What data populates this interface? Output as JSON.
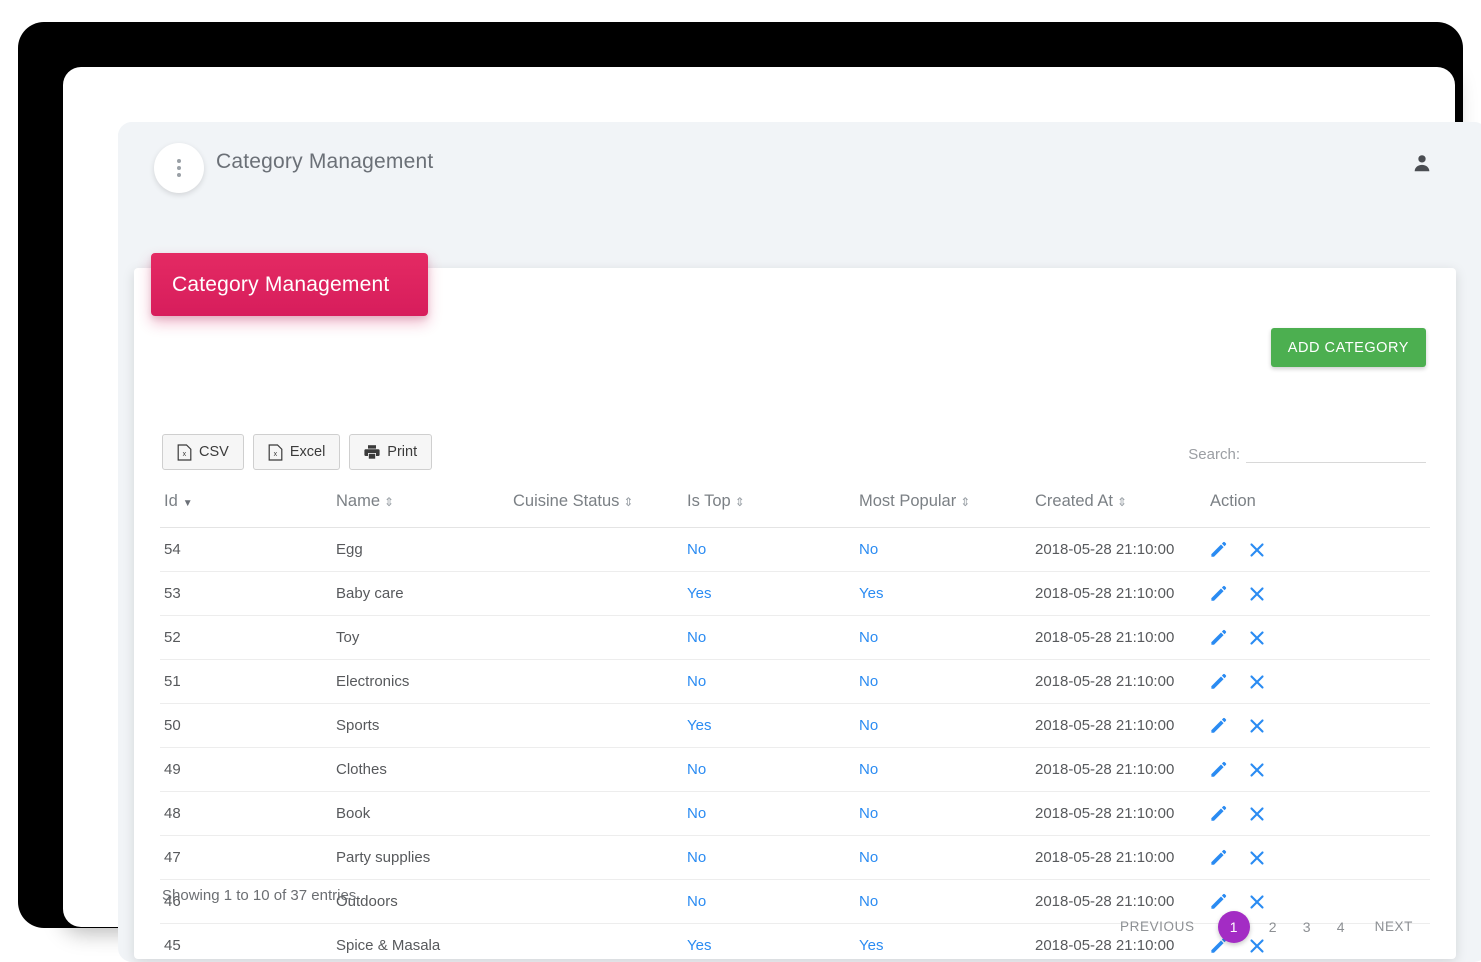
{
  "window": {
    "menu_icon": "three-dots-vertical-icon",
    "topbar_title": "Category Management",
    "user_icon": "user-account-icon"
  },
  "page": {
    "banner_title": "Category Management",
    "banner_color": "#dd2363",
    "add_button_label": "ADD CATEGORY",
    "add_button_color": "#4caf50"
  },
  "export": {
    "buttons": [
      {
        "label": "CSV",
        "icon": "file-csv-icon"
      },
      {
        "label": "Excel",
        "icon": "file-excel-icon"
      },
      {
        "label": "Print",
        "icon": "printer-icon"
      }
    ]
  },
  "search": {
    "label": "Search:",
    "value": "",
    "placeholder": ""
  },
  "table": {
    "columns": [
      {
        "label": "Id",
        "sort": "desc"
      },
      {
        "label": "Name",
        "sort": "both"
      },
      {
        "label": "Cuisine Status",
        "sort": "both"
      },
      {
        "label": "Is Top",
        "sort": "both"
      },
      {
        "label": "Most Popular",
        "sort": "both"
      },
      {
        "label": "Created At",
        "sort": "both"
      },
      {
        "label": "Action",
        "sort": "none"
      }
    ],
    "rows": [
      {
        "id": "54",
        "name": "Egg",
        "cuisine_status": "",
        "is_top": "No",
        "most_popular": "No",
        "created_at": "2018-05-28 21:10:00"
      },
      {
        "id": "53",
        "name": "Baby care",
        "cuisine_status": "",
        "is_top": "Yes",
        "most_popular": "Yes",
        "created_at": "2018-05-28 21:10:00"
      },
      {
        "id": "52",
        "name": "Toy",
        "cuisine_status": "",
        "is_top": "No",
        "most_popular": "No",
        "created_at": "2018-05-28 21:10:00"
      },
      {
        "id": "51",
        "name": "Electronics",
        "cuisine_status": "",
        "is_top": "No",
        "most_popular": "No",
        "created_at": "2018-05-28 21:10:00"
      },
      {
        "id": "50",
        "name": "Sports",
        "cuisine_status": "",
        "is_top": "Yes",
        "most_popular": "No",
        "created_at": "2018-05-28 21:10:00"
      },
      {
        "id": "49",
        "name": "Clothes",
        "cuisine_status": "",
        "is_top": "No",
        "most_popular": "No",
        "created_at": "2018-05-28 21:10:00"
      },
      {
        "id": "48",
        "name": "Book",
        "cuisine_status": "",
        "is_top": "No",
        "most_popular": "No",
        "created_at": "2018-05-28 21:10:00"
      },
      {
        "id": "47",
        "name": "Party supplies",
        "cuisine_status": "",
        "is_top": "No",
        "most_popular": "No",
        "created_at": "2018-05-28 21:10:00"
      },
      {
        "id": "46",
        "name": "Outdoors",
        "cuisine_status": "",
        "is_top": "No",
        "most_popular": "No",
        "created_at": "2018-05-28 21:10:00"
      },
      {
        "id": "45",
        "name": "Spice & Masala",
        "cuisine_status": "",
        "is_top": "Yes",
        "most_popular": "Yes",
        "created_at": "2018-05-28 21:10:00"
      }
    ],
    "action_icons": [
      "edit-pencil-icon",
      "delete-x-icon"
    ],
    "link_color": "#2a8bf2"
  },
  "footer": {
    "showing_entries": "Showing 1 to 10 of 37 entries",
    "pagination": {
      "previous_label": "PREVIOUS",
      "next_label": "NEXT",
      "pages": [
        "1",
        "2",
        "3",
        "4"
      ],
      "active_page": "1",
      "active_color": "#a32cc4"
    }
  }
}
